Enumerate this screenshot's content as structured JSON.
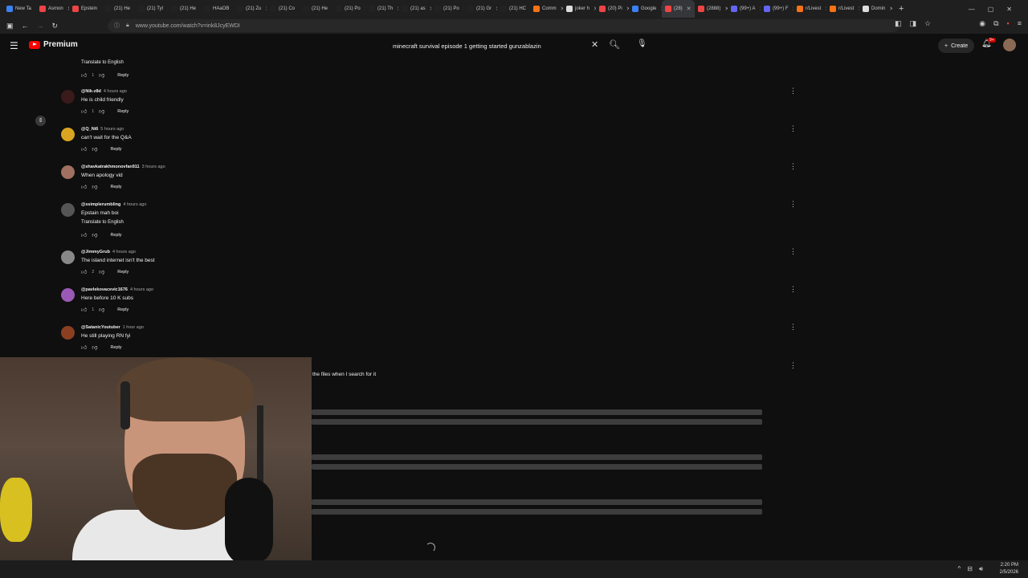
{
  "browser": {
    "tabs": [
      {
        "label": "New Ta",
        "color": "#3b82f6"
      },
      {
        "label": "Asmon",
        "color": "#ef4444"
      },
      {
        "label": "Epstein",
        "color": "#ef4444"
      },
      {
        "label": "(21) He",
        "color": "#222"
      },
      {
        "label": "(21) Tyl",
        "color": "#222"
      },
      {
        "label": "(21) He",
        "color": "#222"
      },
      {
        "label": "HAaOB",
        "color": "#222"
      },
      {
        "label": "(21) Zu",
        "color": "#222"
      },
      {
        "label": "(21) Co",
        "color": "#222"
      },
      {
        "label": "(21) He",
        "color": "#222"
      },
      {
        "label": "(21) Po",
        "color": "#222"
      },
      {
        "label": "(21) Th",
        "color": "#222"
      },
      {
        "label": "(21) as",
        "color": "#222"
      },
      {
        "label": "(21) Po",
        "color": "#222"
      },
      {
        "label": "(21) Gr",
        "color": "#222"
      },
      {
        "label": "(21) HC",
        "color": "#222"
      },
      {
        "label": "Comm",
        "color": "#f97316"
      },
      {
        "label": "joker h",
        "color": "#ddd"
      },
      {
        "label": "(20) Pi",
        "color": "#ef4444"
      },
      {
        "label": "Google",
        "color": "#3b82f6"
      },
      {
        "label": "(28)",
        "color": "#ef4444",
        "active": true
      },
      {
        "label": "(2888)",
        "color": "#ef4444"
      },
      {
        "label": "(99+) A",
        "color": "#6366f1"
      },
      {
        "label": "(99+) F",
        "color": "#6366f1"
      },
      {
        "label": "r/Livest",
        "color": "#f97316"
      },
      {
        "label": "r/Livest",
        "color": "#f97316"
      },
      {
        "label": "Domin",
        "color": "#ddd"
      }
    ],
    "url": "www.youtube.com/watch?v=ink8JcyEWDI"
  },
  "masthead": {
    "logo_text": "Premium",
    "search_value": "minecraft survival episode 1 getting started gunzablazin",
    "create_label": "Create",
    "notification_count": "9+"
  },
  "comments": [
    {
      "translate": "Translate to English",
      "likes": "1",
      "reply": "Reply"
    },
    {
      "author": "@Nik-z8d",
      "time": "4 hours ago",
      "text": "He is child friendly",
      "likes": "1",
      "reply": "Reply",
      "avatar_color": "#3a1a1a"
    },
    {
      "author": "@Q_Ni6",
      "time": "5 hours ago",
      "text": "can't wait for the Q&A",
      "likes": "",
      "reply": "Reply",
      "avatar_color": "#d9a520"
    },
    {
      "author": "@shavkatrakhmonovfan911",
      "time": "3 hours ago",
      "text": "When apology vid",
      "likes": "",
      "reply": "Reply",
      "avatar_color": "#a07060"
    },
    {
      "author": "@ssimplerumbling",
      "time": "4 hours ago",
      "text": "Epstain mah boi",
      "translate": "Translate to English",
      "likes": "",
      "reply": "Reply",
      "avatar_color": "#555555"
    },
    {
      "author": "@JimmyGrub",
      "time": "4 hours ago",
      "text": "The island internet isn't the best",
      "likes": "2",
      "reply": "Reply",
      "avatar_color": "#888888"
    },
    {
      "author": "@pavlekovacevic1676",
      "time": "4 hours ago",
      "text": "Here before 10 K subs",
      "likes": "1",
      "reply": "Reply",
      "avatar_color": "#9b59b6"
    },
    {
      "author": "@SatanicYoutuber",
      "time": "1 hour ago",
      "text": "He still playing RN fyi",
      "likes": "",
      "reply": "Reply",
      "avatar_color": "#8a4020"
    }
  ],
  "partial_comment": "the files when I search for it",
  "taskbar": {
    "time": "2:20 PM",
    "date": "2/5/2026"
  }
}
